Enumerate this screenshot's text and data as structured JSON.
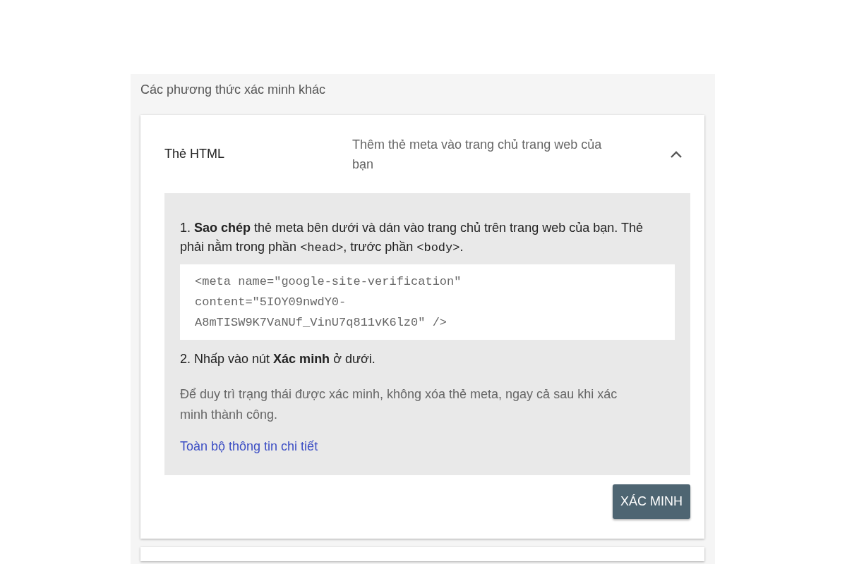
{
  "section_title": "Các phương thức xác minh khác",
  "method": {
    "name": "Thẻ HTML",
    "description": "Thêm thẻ meta vào trang chủ trang web của bạn",
    "expanded": true,
    "steps": [
      {
        "parts": [
          {
            "kind": "text",
            "text": "1. "
          },
          {
            "kind": "bold",
            "text": "Sao chép"
          },
          {
            "kind": "text",
            "text": " thẻ meta bên dưới và dán vào trang chủ trên trang web của bạn. Thẻ phải nằm trong phần "
          },
          {
            "kind": "code",
            "text": "<head>"
          },
          {
            "kind": "text",
            "text": ", trước phần "
          },
          {
            "kind": "code",
            "text": "<body>"
          },
          {
            "kind": "text",
            "text": "."
          }
        ],
        "code_lines": [
          "<meta name=\"google-site-verification\"",
          "content=\"5IOY09nwdY0-",
          "A8mTISW9K7VaNUf_VinU7q811vK6lz0\" />"
        ]
      },
      {
        "parts": [
          {
            "kind": "text",
            "text": "2. Nhấp vào nút "
          },
          {
            "kind": "bold",
            "text": "Xác minh"
          },
          {
            "kind": "text",
            "text": " ở dưới."
          }
        ]
      }
    ],
    "note": "Để duy trì trạng thái được xác minh, không xóa thẻ meta, ngay cả sau khi xác minh thành công.",
    "link": "Toàn bộ thông tin chi tiết",
    "button": "XÁC MINH"
  }
}
